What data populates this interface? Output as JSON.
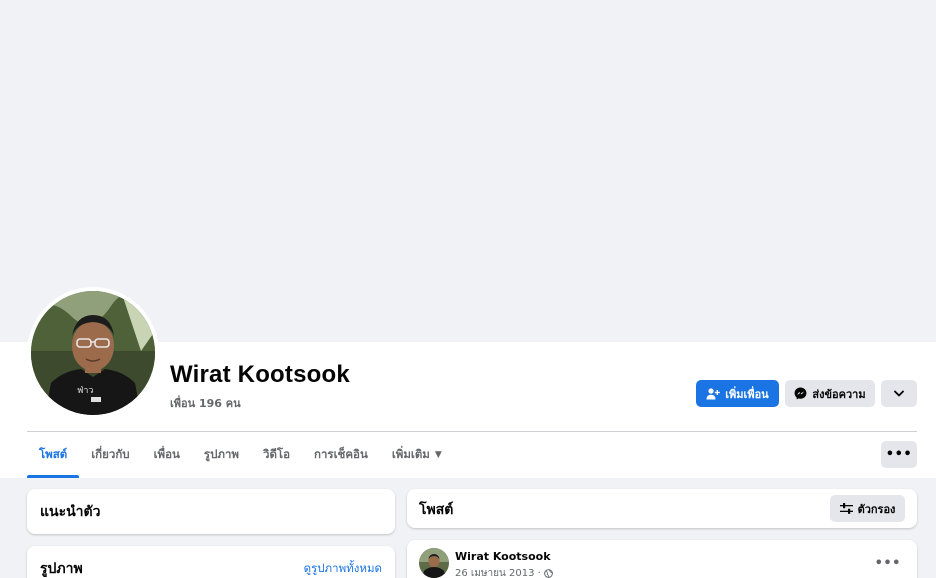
{
  "profile": {
    "name": "Wirat Kootsook",
    "friends_count": "เพื่อน 196 คน"
  },
  "actions": {
    "add_friend_label": "เพิ่มเพื่อน",
    "message_label": "ส่งข้อความ"
  },
  "tabs": [
    {
      "label": "โพสต์",
      "active": true
    },
    {
      "label": "เกี่ยวกับ",
      "active": false
    },
    {
      "label": "เพื่อน",
      "active": false
    },
    {
      "label": "รูปภาพ",
      "active": false
    },
    {
      "label": "วิดีโอ",
      "active": false
    },
    {
      "label": "การเช็คอิน",
      "active": false
    },
    {
      "label": "เพิ่มเติม",
      "active": false
    }
  ],
  "intro": {
    "title": "แนะนำตัว"
  },
  "photos": {
    "title": "รูปภาพ",
    "see_all": "ดูรูปภาพทั้งหมด"
  },
  "posts": {
    "title": "โพสต์",
    "filter_label": "ตัวกรอง"
  },
  "post": {
    "author": "Wirat Kootsook",
    "date": "26 เมษายน 2013 ·"
  },
  "colors": {
    "accent": "#1b74e4",
    "background": "#f0f2f5",
    "button_gray": "#e4e6eb",
    "secondary_text": "#65676b"
  },
  "icons": {
    "add_friend": "person-plus-icon",
    "messenger": "messenger-icon",
    "chevron": "chevron-down-icon",
    "more": "more-dots-icon",
    "filter": "filter-sliders-icon",
    "globe": "globe-icon"
  }
}
